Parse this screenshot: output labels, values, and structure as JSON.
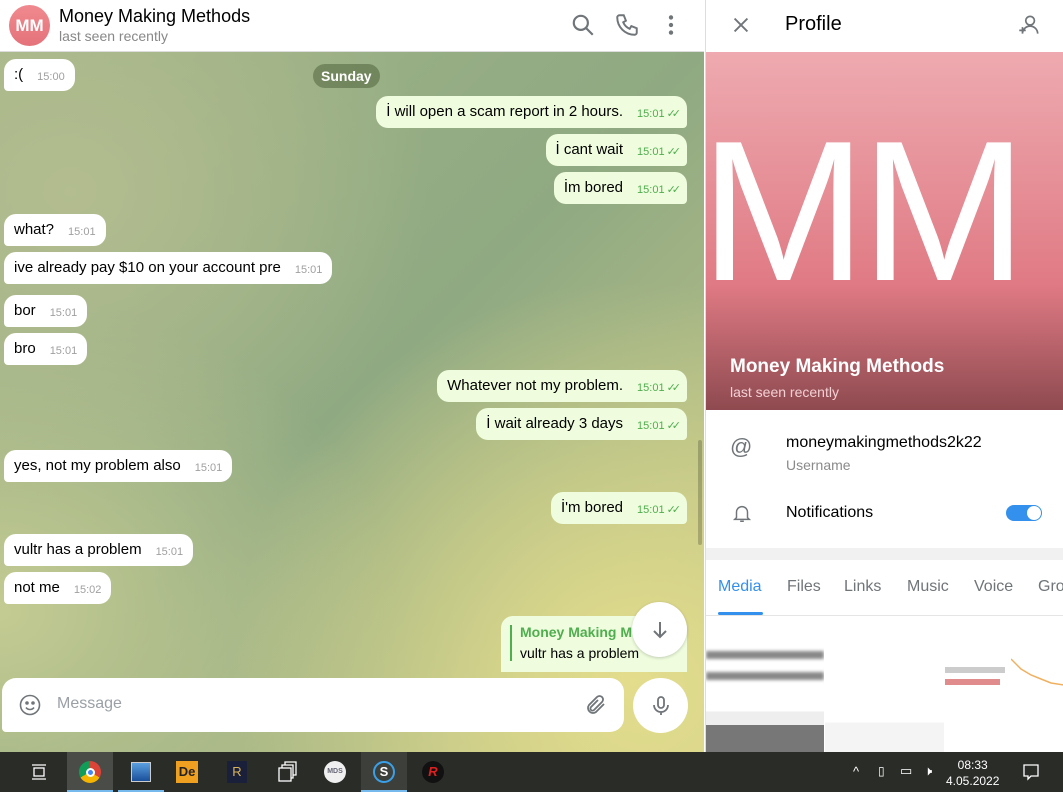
{
  "chat": {
    "title": "Money Making Methods",
    "status": "last seen recently",
    "avatar_initials": "MM",
    "date_separator": "Sunday",
    "messages": [
      {
        "dir": "in",
        "text": ":(",
        "time": "15:00"
      },
      {
        "dir": "out",
        "text": "İ will open a scam report in 2 hours.",
        "time": "15:01"
      },
      {
        "dir": "out",
        "text": "İ cant wait",
        "time": "15:01"
      },
      {
        "dir": "out",
        "text": "İm bored",
        "time": "15:01"
      },
      {
        "dir": "in",
        "text": "what?",
        "time": "15:01"
      },
      {
        "dir": "in",
        "text": "ive already pay $10 on your account pre",
        "time": "15:01"
      },
      {
        "dir": "in",
        "text": "bor",
        "time": "15:01"
      },
      {
        "dir": "in",
        "text": "bro",
        "time": "15:01"
      },
      {
        "dir": "out",
        "text": "Whatever not my problem.",
        "time": "15:01"
      },
      {
        "dir": "out",
        "text": "İ wait already 3 days",
        "time": "15:01"
      },
      {
        "dir": "in",
        "text": "yes, not my problem also",
        "time": "15:01"
      },
      {
        "dir": "out",
        "text": "İ'm bored",
        "time": "15:01"
      },
      {
        "dir": "in",
        "text": "vultr has a problem",
        "time": "15:01"
      },
      {
        "dir": "in",
        "text": "not me",
        "time": "15:02"
      }
    ],
    "reply": {
      "name": "Money Making Methods",
      "text": "vultr has a problem"
    },
    "composer_placeholder": "Message"
  },
  "profile": {
    "header": "Profile",
    "avatar_initials": "MM",
    "name": "Money Making Methods",
    "status": "last seen recently",
    "username": "moneymakingmethods2k22",
    "username_label": "Username",
    "notifications_label": "Notifications",
    "notifications_on": true,
    "tabs": [
      "Media",
      "Files",
      "Links",
      "Music",
      "Voice",
      "Gro"
    ],
    "active_tab": "Media"
  },
  "taskbar": {
    "time": "08:33",
    "date": "4.05.2022"
  },
  "colors": {
    "accent": "#3390ec",
    "outgoing": "#effdde",
    "check": "#4fae4e"
  }
}
